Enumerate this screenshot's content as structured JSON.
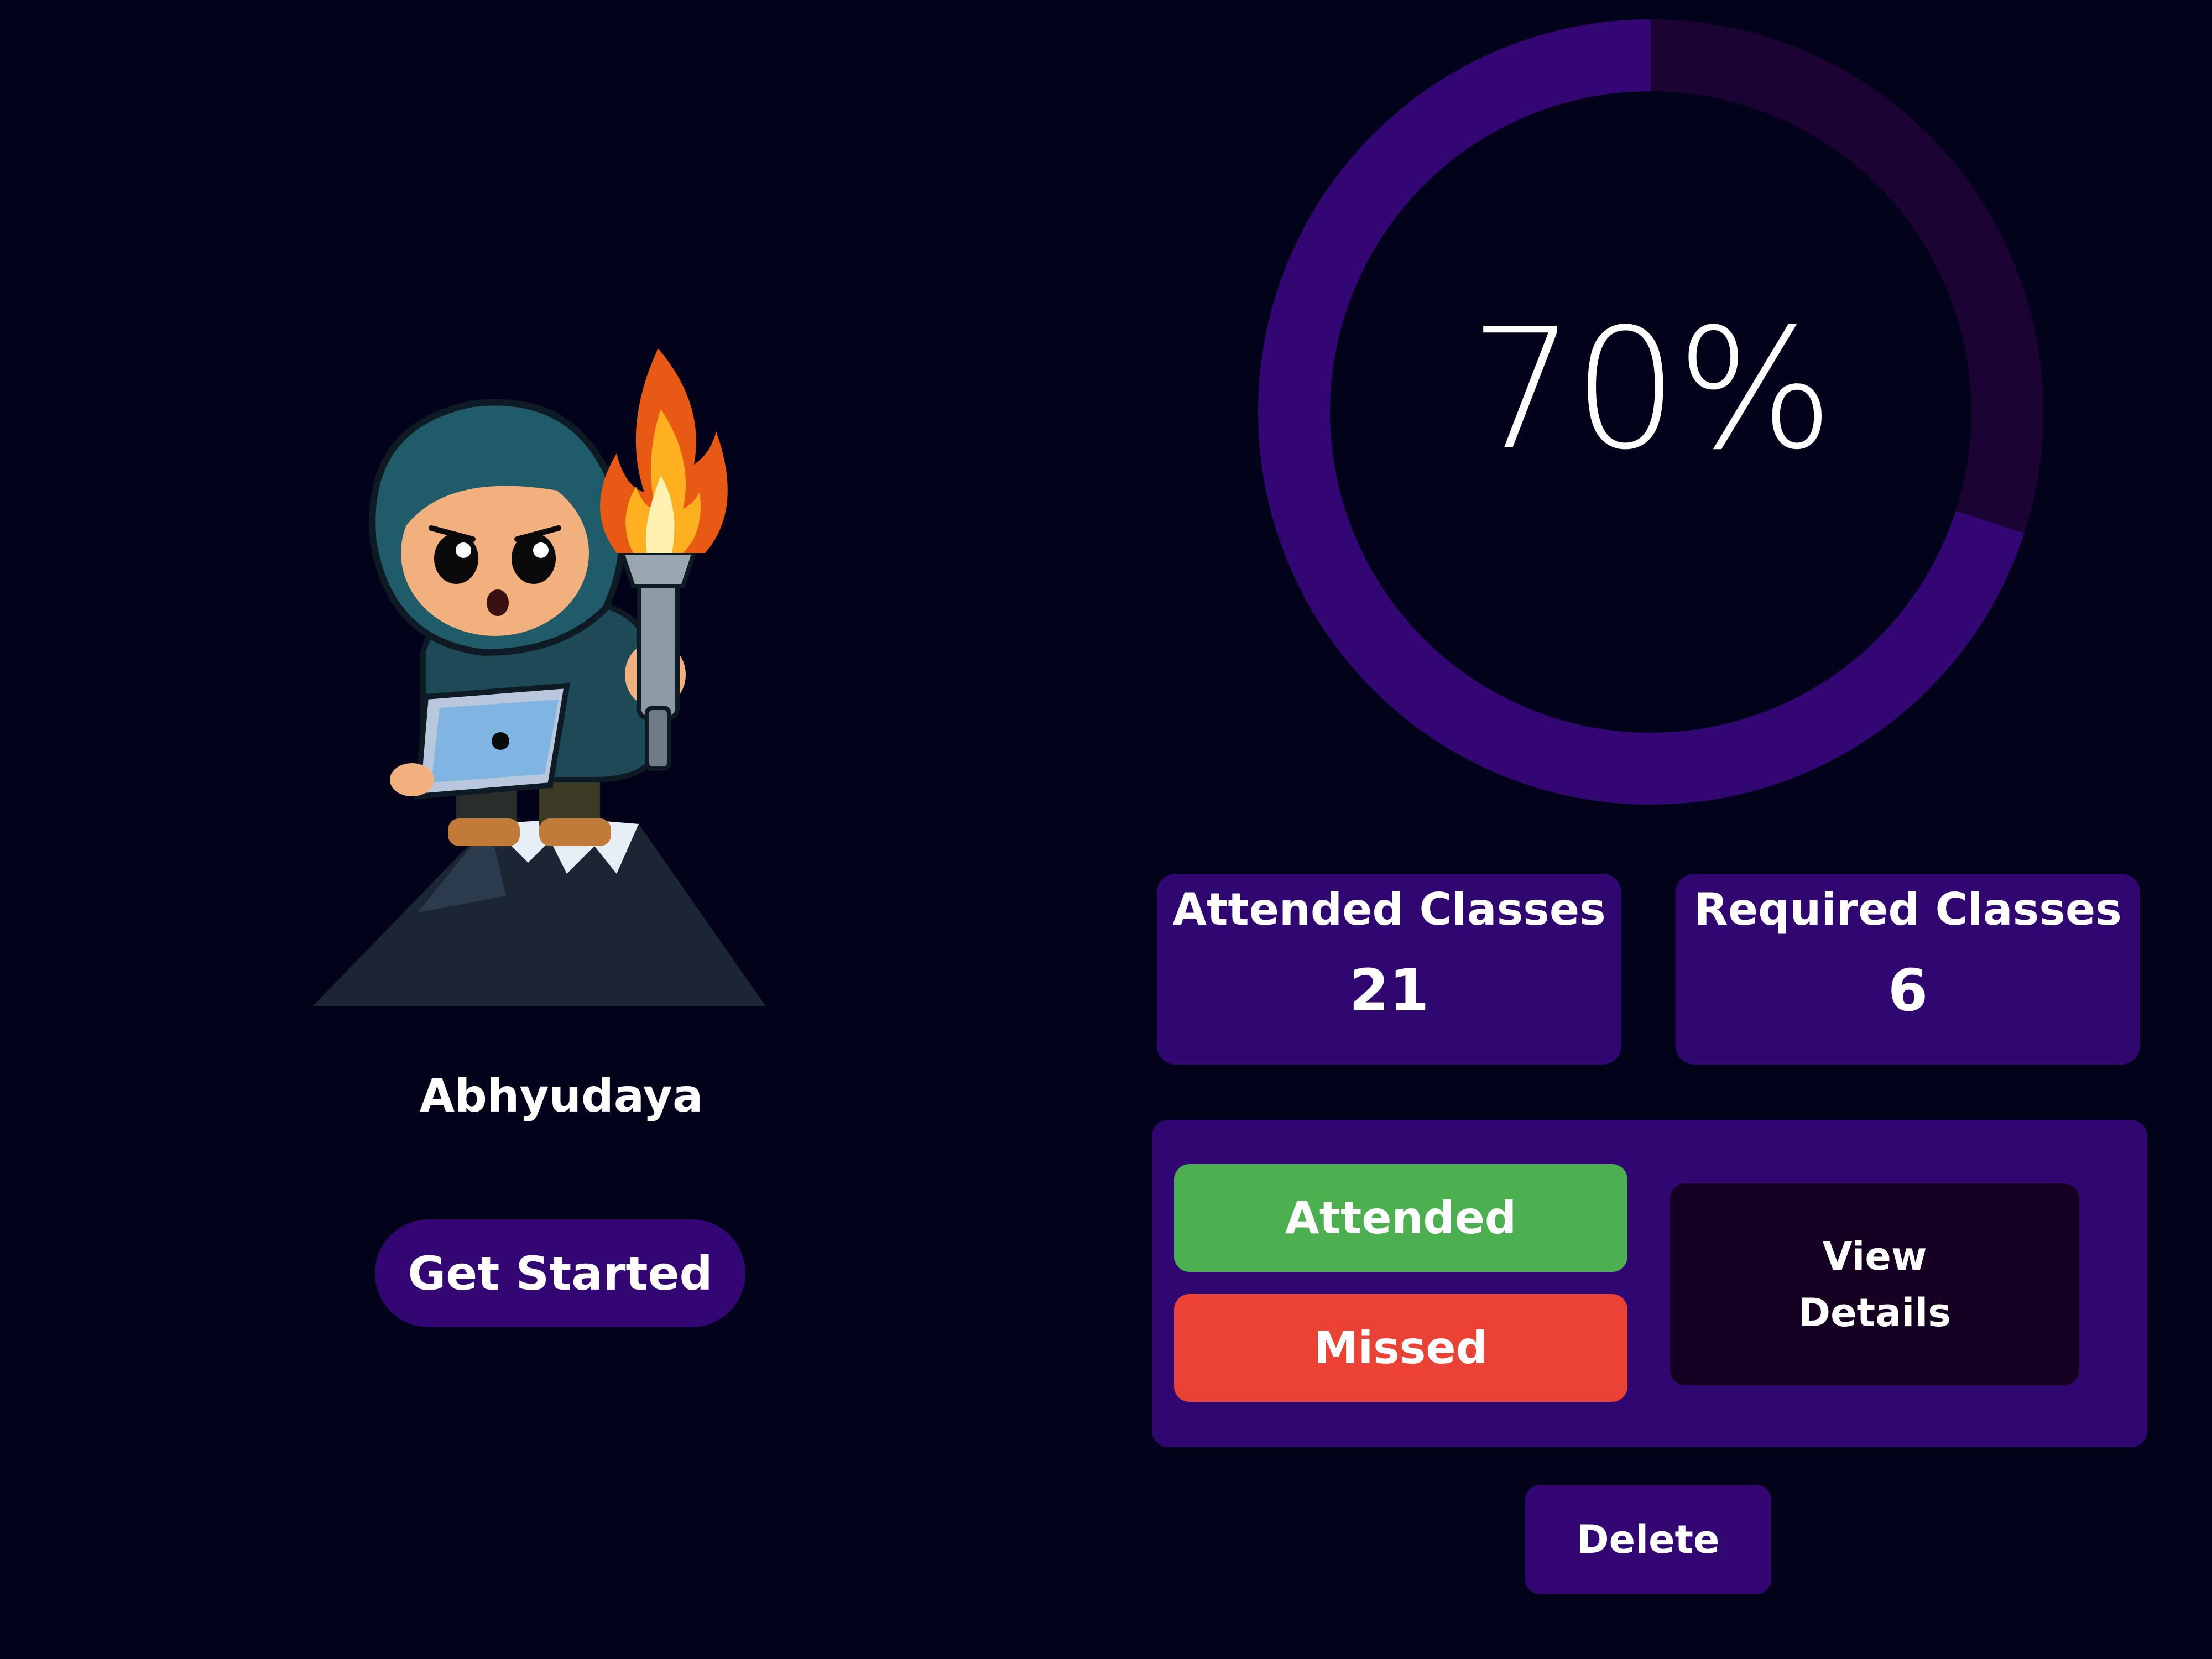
{
  "profile": {
    "name": "Abhyudaya",
    "cta_label": "Get Started"
  },
  "progress": {
    "percent_label": "70%",
    "fraction": 0.7,
    "track_color": "#1b0433",
    "fill_color": "#330773"
  },
  "stats": {
    "attended": {
      "label": "Attended Classes",
      "value": "21"
    },
    "required": {
      "label": "Required Classes",
      "value": "6"
    }
  },
  "actions": {
    "attended_label": "Attended",
    "missed_label": "Missed",
    "view_details_label": "View Details",
    "delete_label": "Delete"
  },
  "colors": {
    "background": "#02021a",
    "panel": "#300770",
    "attended": "#4caf50",
    "missed": "#ea4335",
    "view_details": "#150021"
  },
  "icons": {
    "mascot": "hooded-coder-with-torch-illustration"
  }
}
